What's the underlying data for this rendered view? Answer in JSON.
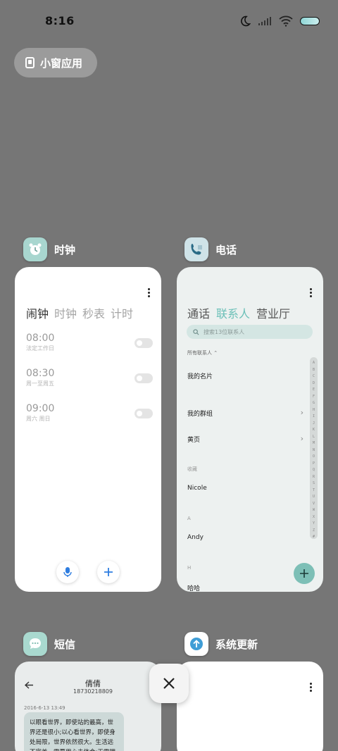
{
  "status_bar": {
    "time": "8:16"
  },
  "small_window": {
    "label": "小窗应用"
  },
  "apps": {
    "clock": {
      "name": "时钟",
      "tabs": [
        "闹钟",
        "时钟",
        "秒表",
        "计时"
      ],
      "alarms": [
        {
          "time": "08:00",
          "repeat": "法定工作日"
        },
        {
          "time": "08:30",
          "repeat": "周一至周五"
        },
        {
          "time": "09:00",
          "repeat": "周六 周日"
        }
      ]
    },
    "phone": {
      "name": "电话",
      "tabs": [
        "通话",
        "联系人",
        "营业厅"
      ],
      "search_placeholder": "搜索13位联系人",
      "all_contacts": "所有联系人",
      "my_card": "我的名片",
      "my_groups": "我的群组",
      "yellow_pages": "黄页",
      "favorites_header": "收藏",
      "favorite_contact": "Nicole",
      "section_a": "A",
      "contact_a": "Andy",
      "section_h": "H",
      "contact_h": "哈哈",
      "alphabet": [
        "A",
        "B",
        "C",
        "D",
        "E",
        "F",
        "G",
        "H",
        "I",
        "J",
        "K",
        "L",
        "M",
        "N",
        "O",
        "P",
        "Q",
        "R",
        "S",
        "T",
        "U",
        "V",
        "W",
        "X",
        "Y",
        "Z",
        "#"
      ]
    },
    "sms": {
      "name": "短信",
      "contact": "倩倩",
      "number": "18730218809",
      "date": "2016-6-13 13:49",
      "message": "以眼看世界，即使站的最高，世界还是很小;以心看世界，即使身处局限，世界依然很大。生活远不完美，需要用心去体会;无需拥有太"
    },
    "update": {
      "name": "系统更新"
    }
  },
  "colors": {
    "background": "#767676",
    "phone_accent": "#6cc0b8",
    "clock_icon_bg": "#a8d6cf",
    "update_icon": "#3f9dd6"
  }
}
